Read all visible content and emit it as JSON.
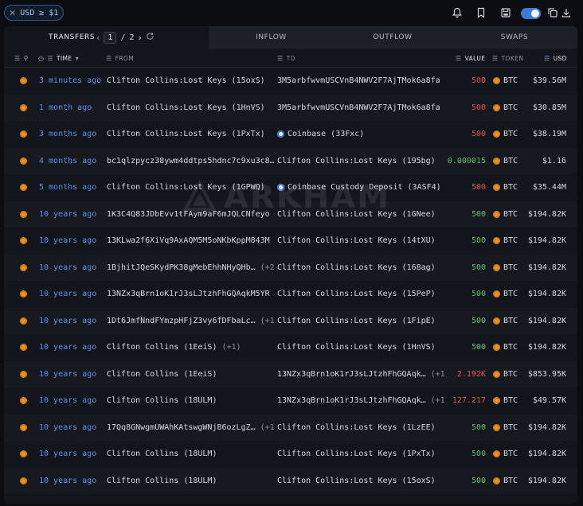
{
  "filter_chip": {
    "label": "USD ≥ $1",
    "close_icon": "close-icon"
  },
  "toolbar": {
    "icons": [
      "alert-bell-icon",
      "bookmark-icon",
      "save-icon",
      "copy-icon",
      "download-icon"
    ],
    "toggle_on": true
  },
  "tabs": {
    "transfers": "TRANSFERS",
    "inflow": "INFLOW",
    "outflow": "OUTFLOW",
    "swaps": "SWAPS"
  },
  "pager": {
    "current": "1",
    "separator": "/",
    "total": "2"
  },
  "columns": {
    "time": "TIME",
    "from": "FROM",
    "to": "TO",
    "value": "VALUE",
    "token": "TOKEN",
    "usd": "USD"
  },
  "colors": {
    "accent": "#5b8ee6",
    "red": "#e04d4d",
    "green": "#5fb96a",
    "btc": "#f0931a"
  },
  "rows": [
    {
      "time": "3 minutes ago",
      "from": {
        "entity": "Clifton Collins",
        "label": "Lost Keys (15oxS)",
        "extra": ""
      },
      "to": {
        "addr": "3M5arbfwvmUSCVnB4NWV2F7AjTMok6a8fa",
        "extra": ""
      },
      "value": "500",
      "value_color": "red",
      "token": "BTC",
      "usd": "$39.56M"
    },
    {
      "time": "1 month ago",
      "from": {
        "entity": "Clifton Collins",
        "label": "Lost Keys (1HnVS)",
        "extra": ""
      },
      "to": {
        "addr": "3M5arbfwvmUSCVnB4NWV2F7AjTMok6a8fa",
        "extra": ""
      },
      "value": "500",
      "value_color": "red",
      "token": "BTC",
      "usd": "$30.85M"
    },
    {
      "time": "3 months ago",
      "from": {
        "entity": "Clifton Collins",
        "label": "Lost Keys (1PxTx)",
        "extra": ""
      },
      "to": {
        "addr": "Coinbase (33Fxc)",
        "extra": "",
        "coinbase": true
      },
      "value": "500",
      "value_color": "red",
      "token": "BTC",
      "usd": "$38.19M"
    },
    {
      "time": "4 months ago",
      "from": {
        "addr": "bc1qlzpycz38ywm4ddtps5hdnc7c9xu3c8…",
        "extra": ""
      },
      "to": {
        "entity": "Clifton Collins",
        "label": "Lost Keys (195bg)",
        "extra": ""
      },
      "value": "0.000015",
      "value_color": "green",
      "token": "BTC",
      "usd": "$1.16"
    },
    {
      "time": "5 months ago",
      "from": {
        "entity": "Clifton Collins",
        "label": "Lost Keys (1GPWQ)",
        "extra": ""
      },
      "to": {
        "addr": "Coinbase Custody Deposit (3ASF4)",
        "extra": "",
        "coinbase": true
      },
      "value": "500",
      "value_color": "red",
      "token": "BTC",
      "usd": "$35.44M"
    },
    {
      "time": "10 years ago",
      "from": {
        "addr": "1K3C4Q83JDbEvv1tFAym9aF6mJQLCNfeyo",
        "extra": ""
      },
      "to": {
        "entity": "Clifton Collins",
        "label": "Lost Keys (1GNee)",
        "extra": ""
      },
      "value": "500",
      "value_color": "green",
      "token": "BTC",
      "usd": "$194.82K"
    },
    {
      "time": "10 years ago",
      "from": {
        "addr": "13KLwa2f6XiVq9AxAQM5M5oNKbKppM843M",
        "extra": ""
      },
      "to": {
        "entity": "Clifton Collins",
        "label": "Lost Keys (14tXU)",
        "extra": ""
      },
      "value": "500",
      "value_color": "green",
      "token": "BTC",
      "usd": "$194.82K"
    },
    {
      "time": "10 years ago",
      "from": {
        "addr": "1BjhitJQeSKydPK38gMebEhhNHyQHb…",
        "extra": "(+2)"
      },
      "to": {
        "entity": "Clifton Collins",
        "label": "Lost Keys (168ag)",
        "extra": ""
      },
      "value": "500",
      "value_color": "green",
      "token": "BTC",
      "usd": "$194.82K"
    },
    {
      "time": "10 years ago",
      "from": {
        "addr": "13NZx3qBrn1oK1rJ3sLJtzhFhGQAqkM5YR",
        "extra": ""
      },
      "to": {
        "entity": "Clifton Collins",
        "label": "Lost Keys (15PeP)",
        "extra": ""
      },
      "value": "500",
      "value_color": "green",
      "token": "BTC",
      "usd": "$194.82K"
    },
    {
      "time": "10 years ago",
      "from": {
        "addr": "1Dt6JmfNndFYmzpHFjZ3vy6fDFbaLc…",
        "extra": "(+1)"
      },
      "to": {
        "entity": "Clifton Collins",
        "label": "Lost Keys (1FipE)",
        "extra": ""
      },
      "value": "500",
      "value_color": "green",
      "token": "BTC",
      "usd": "$194.82K"
    },
    {
      "time": "10 years ago",
      "from": {
        "addr": "Clifton Collins (1EeiS)",
        "extra": "(+1)"
      },
      "to": {
        "entity": "Clifton Collins",
        "label": "Lost Keys (1HnVS)",
        "extra": ""
      },
      "value": "500",
      "value_color": "green",
      "token": "BTC",
      "usd": "$194.82K"
    },
    {
      "time": "10 years ago",
      "from": {
        "addr": "Clifton Collins (1EeiS)",
        "extra": ""
      },
      "to": {
        "addr": "13NZx3qBrn1oK1rJ3sLJtzhFhGQAqk…",
        "extra": "(+1)"
      },
      "value": "2.192K",
      "value_color": "red",
      "token": "BTC",
      "usd": "$853.95K"
    },
    {
      "time": "10 years ago",
      "from": {
        "addr": "Clifton Collins (18ULM)",
        "extra": ""
      },
      "to": {
        "addr": "13NZx3qBrn1oK1rJ3sLJtzhFhGQAqk…",
        "extra": "(+1)"
      },
      "value": "127.217",
      "value_color": "red",
      "token": "BTC",
      "usd": "$49.57K"
    },
    {
      "time": "10 years ago",
      "from": {
        "addr": "17Qq8GNwgmUWAhKAtswgWNjB6ozLgZ…",
        "extra": "(+1)"
      },
      "to": {
        "entity": "Clifton Collins",
        "label": "Lost Keys (1LzEE)",
        "extra": ""
      },
      "value": "500",
      "value_color": "green",
      "token": "BTC",
      "usd": "$194.82K"
    },
    {
      "time": "10 years ago",
      "from": {
        "addr": "Clifton Collins (18ULM)",
        "extra": ""
      },
      "to": {
        "entity": "Clifton Collins",
        "label": "Lost Keys (1PxTx)",
        "extra": ""
      },
      "value": "500",
      "value_color": "green",
      "token": "BTC",
      "usd": "$194.82K"
    },
    {
      "time": "10 years ago",
      "from": {
        "addr": "Clifton Collins (18ULM)",
        "extra": ""
      },
      "to": {
        "entity": "Clifton Collins",
        "label": "Lost Keys (15oxS)",
        "extra": ""
      },
      "value": "500",
      "value_color": "green",
      "token": "BTC",
      "usd": "$194.82K"
    }
  ],
  "watermark": {
    "text": "ARKHAM"
  }
}
